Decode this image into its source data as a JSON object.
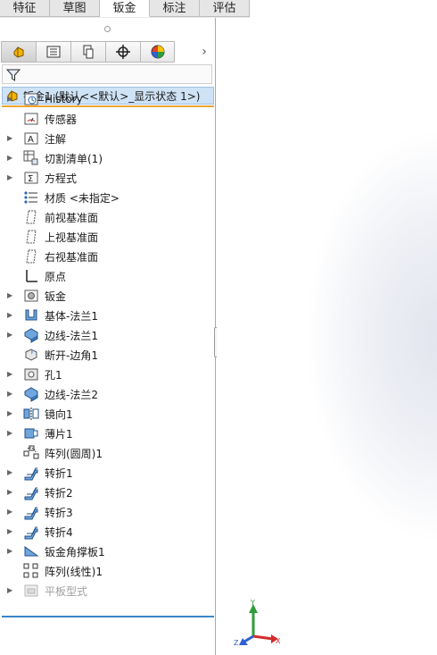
{
  "command_tabs": [
    {
      "label": "特征",
      "active": false
    },
    {
      "label": "草图",
      "active": false
    },
    {
      "label": "钣金",
      "active": true
    },
    {
      "label": "标注",
      "active": false
    },
    {
      "label": "评估",
      "active": false
    }
  ],
  "panel_toolbar": {
    "buttons": [
      "featuremanager-icon",
      "propertymanager-icon",
      "configurationmanager-icon",
      "dimxpert-icon",
      "display-manager-icon"
    ],
    "more_label": "›"
  },
  "root": {
    "label": "钣金1  (默认<<默认>_显示状态 1>)"
  },
  "tree_items": [
    {
      "label": "History",
      "icon": "history-icon",
      "expandable": true,
      "dim": false
    },
    {
      "label": "传感器",
      "icon": "sensor-icon",
      "expandable": false,
      "dim": false
    },
    {
      "label": "注解",
      "icon": "annotations-icon",
      "expandable": true,
      "dim": false
    },
    {
      "label": "切割清单(1)",
      "icon": "cut-list-icon",
      "expandable": true,
      "dim": false
    },
    {
      "label": "方程式",
      "icon": "equations-icon",
      "expandable": true,
      "dim": false
    },
    {
      "label": "材质 <未指定>",
      "icon": "material-icon",
      "expandable": false,
      "dim": false
    },
    {
      "label": "前视基准面",
      "icon": "plane-icon",
      "expandable": false,
      "dim": false
    },
    {
      "label": "上视基准面",
      "icon": "plane-icon",
      "expandable": false,
      "dim": false
    },
    {
      "label": "右视基准面",
      "icon": "plane-icon",
      "expandable": false,
      "dim": false
    },
    {
      "label": "原点",
      "icon": "origin-icon",
      "expandable": false,
      "dim": false
    },
    {
      "label": "钣金",
      "icon": "sheet-metal-icon",
      "expandable": true,
      "dim": false
    },
    {
      "label": "基体-法兰1",
      "icon": "base-flange-icon",
      "expandable": true,
      "dim": false
    },
    {
      "label": "边线-法兰1",
      "icon": "edge-flange-icon",
      "expandable": true,
      "dim": false
    },
    {
      "label": "断开-边角1",
      "icon": "break-corner-icon",
      "expandable": false,
      "dim": false
    },
    {
      "label": "孔1",
      "icon": "hole-icon",
      "expandable": true,
      "dim": false
    },
    {
      "label": "边线-法兰2",
      "icon": "edge-flange-icon",
      "expandable": true,
      "dim": false
    },
    {
      "label": "镜向1",
      "icon": "mirror-icon",
      "expandable": true,
      "dim": false
    },
    {
      "label": "薄片1",
      "icon": "tab-icon",
      "expandable": true,
      "dim": false
    },
    {
      "label": "阵列(圆周)1",
      "icon": "circular-pattern-icon",
      "expandable": false,
      "dim": false
    },
    {
      "label": "转折1",
      "icon": "jog-icon",
      "expandable": true,
      "dim": false
    },
    {
      "label": "转折2",
      "icon": "jog-icon",
      "expandable": true,
      "dim": false
    },
    {
      "label": "转折3",
      "icon": "jog-icon",
      "expandable": true,
      "dim": false
    },
    {
      "label": "转折4",
      "icon": "jog-icon",
      "expandable": true,
      "dim": false
    },
    {
      "label": "钣金角撑板1",
      "icon": "gusset-icon",
      "expandable": true,
      "dim": false
    },
    {
      "label": "阵列(线性)1",
      "icon": "linear-pattern-icon",
      "expandable": false,
      "dim": false
    },
    {
      "label": "平板型式",
      "icon": "flat-pattern-icon",
      "expandable": true,
      "dim": true
    }
  ],
  "triad": {
    "x_label": "X",
    "y_label": "Y",
    "z_label": "Z"
  },
  "colors": {
    "selection": "#cfe3f6",
    "rollback_bar": "#3a86c8",
    "highlight_bar": "#f0a431"
  }
}
